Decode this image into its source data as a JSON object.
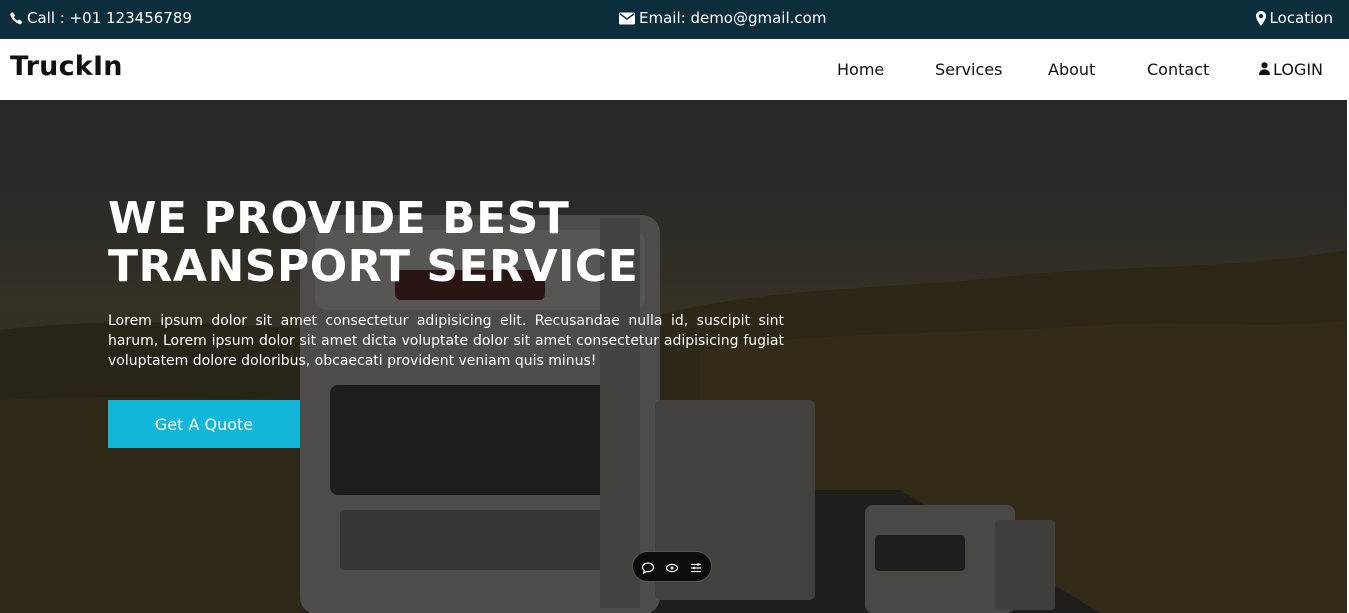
{
  "topbar": {
    "call": "Call : +01 123456789",
    "email": "Email: demo@gmail.com",
    "location": "Location",
    "background": "#0c2e3c"
  },
  "navbar": {
    "brand": "TruckIn",
    "links": [
      {
        "label": "Home"
      },
      {
        "label": "Services"
      },
      {
        "label": "About"
      },
      {
        "label": "Contact"
      }
    ],
    "login": "LOGIN"
  },
  "hero": {
    "title_line1": "WE PROVIDE BEST",
    "title_line2": "TRANSPORT SERVICE",
    "text": "Lorem ipsum dolor sit amet consectetur adipisicing elit. Recusandae nulla id, suscipit sint harum, Lorem ipsum dolor sit amet dicta voluptate dolor sit amet consectetur adipisicing fugiat voluptatem dolore doloribus, obcaecati provident veniam quis minus!",
    "cta": "Get A Quote",
    "cta_color": "#12b6d8",
    "background_image": "trucks-and-forest-photo"
  },
  "floating_toolbar": {
    "icons": [
      "comment-icon",
      "eye-icon",
      "menu-icon"
    ]
  }
}
